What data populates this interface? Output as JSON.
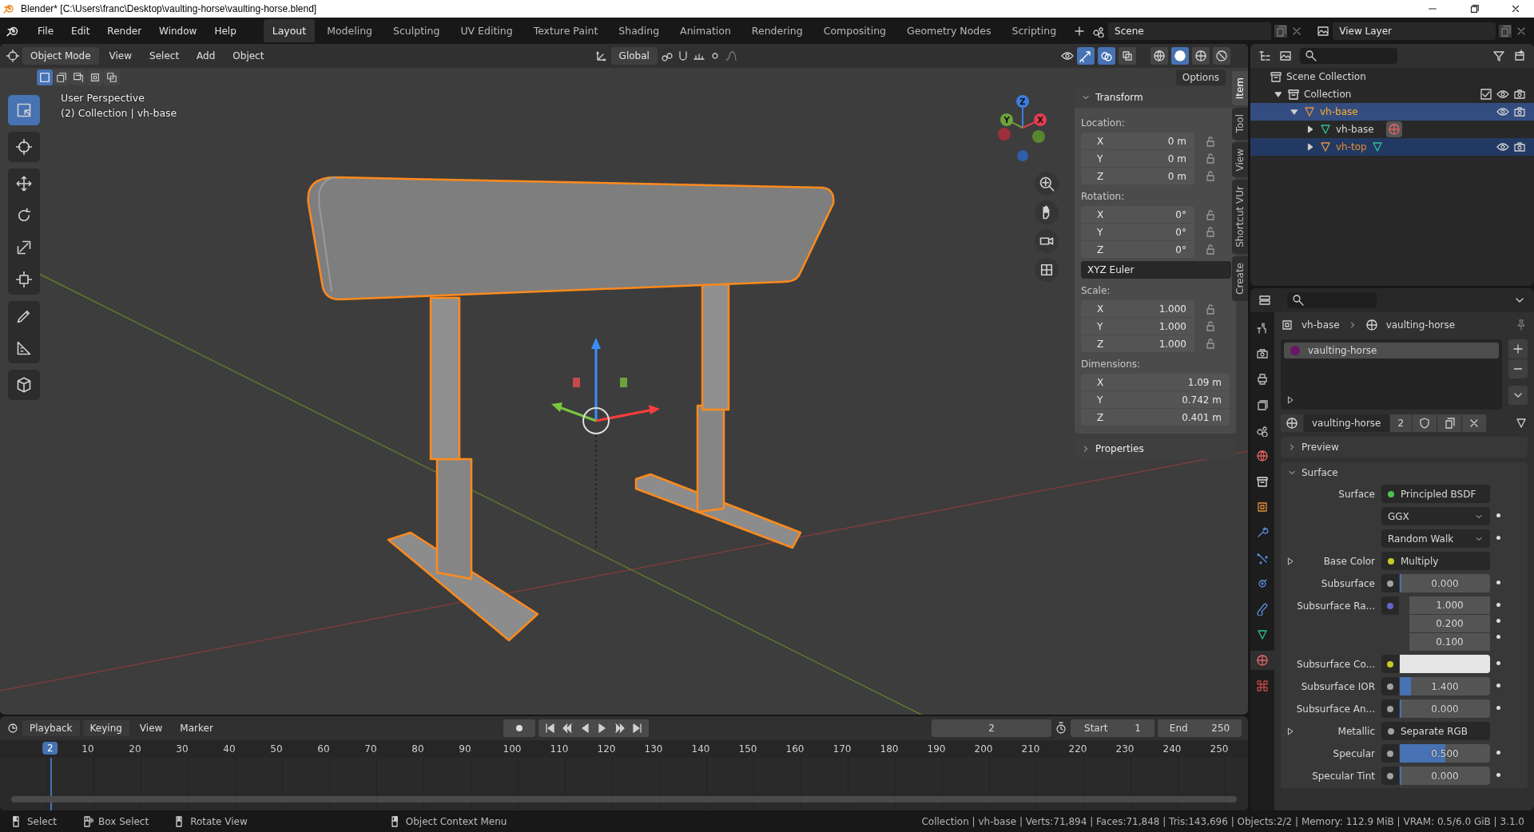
{
  "window": {
    "title": "Blender* [C:\\Users\\franc\\Desktop\\vaulting-horse\\vaulting-horse.blend]"
  },
  "menu": [
    "File",
    "Edit",
    "Render",
    "Window",
    "Help"
  ],
  "workspaces": [
    {
      "label": "Layout",
      "selected": true
    },
    {
      "label": "Modeling",
      "selected": false
    },
    {
      "label": "Sculpting",
      "selected": false
    },
    {
      "label": "UV Editing",
      "selected": false
    },
    {
      "label": "Texture Paint",
      "selected": false
    },
    {
      "label": "Shading",
      "selected": false
    },
    {
      "label": "Animation",
      "selected": false
    },
    {
      "label": "Rendering",
      "selected": false
    },
    {
      "label": "Compositing",
      "selected": false
    },
    {
      "label": "Geometry Nodes",
      "selected": false
    },
    {
      "label": "Scripting",
      "selected": false
    }
  ],
  "scene": {
    "scene": "Scene",
    "view_layer": "View Layer"
  },
  "viewport": {
    "mode": "Object Mode",
    "menus": [
      "View",
      "Select",
      "Add",
      "Object"
    ],
    "orientation": "Global",
    "options": "Options",
    "select_modes": [
      {
        "kind": "set",
        "selected": true
      },
      {
        "kind": "extend",
        "selected": false
      },
      {
        "kind": "subtract",
        "selected": false
      },
      {
        "kind": "invert",
        "selected": false
      },
      {
        "kind": "intersect",
        "selected": false
      }
    ],
    "toggles": [
      {
        "kind": "gizmo",
        "on": true
      },
      {
        "kind": "overlay",
        "on": true
      },
      {
        "kind": "xray",
        "on": false
      }
    ],
    "shading": [
      {
        "kind": "wireframe",
        "selected": false
      },
      {
        "kind": "solid",
        "selected": true
      },
      {
        "kind": "material",
        "selected": false
      },
      {
        "kind": "rendered",
        "selected": false
      }
    ],
    "info": [
      "User Perspective",
      "(2) Collection | vh-base"
    ],
    "tools": [
      {
        "kind": "select",
        "selected": true
      },
      {
        "kind": "cursor",
        "selected": false
      },
      {
        "kind": "move",
        "selected": false
      },
      {
        "kind": "rotate",
        "selected": false
      },
      {
        "kind": "scale",
        "selected": false
      },
      {
        "kind": "transform",
        "selected": false
      },
      {
        "kind": "annotate",
        "selected": false
      },
      {
        "kind": "measure",
        "selected": false
      },
      {
        "kind": "add-cube",
        "selected": false
      }
    ],
    "gizmo_labels": [
      "Z",
      "Y",
      "X"
    ]
  },
  "n_panel": {
    "title": "Transform",
    "groups": [
      {
        "label": "Location:",
        "locks": true,
        "fields": [
          {
            "axis": "X",
            "value": "0 m"
          },
          {
            "axis": "Y",
            "value": "0 m"
          },
          {
            "axis": "Z",
            "value": "0 m"
          }
        ]
      },
      {
        "label": "Rotation:",
        "locks": true,
        "fields": [
          {
            "axis": "X",
            "value": "0°"
          },
          {
            "axis": "Y",
            "value": "0°"
          },
          {
            "axis": "Z",
            "value": "0°"
          }
        ],
        "mode": "XYZ Euler"
      },
      {
        "label": "Scale:",
        "locks": true,
        "fields": [
          {
            "axis": "X",
            "value": "1.000"
          },
          {
            "axis": "Y",
            "value": "1.000"
          },
          {
            "axis": "Z",
            "value": "1.000"
          }
        ]
      },
      {
        "label": "Dimensions:",
        "locks": false,
        "fields": [
          {
            "axis": "X",
            "value": "1.09 m"
          },
          {
            "axis": "Y",
            "value": "0.742 m"
          },
          {
            "axis": "Z",
            "value": "0.401 m"
          }
        ]
      }
    ],
    "properties": "Properties",
    "tabs": [
      {
        "label": "Item",
        "selected": true
      },
      {
        "label": "Tool",
        "selected": false
      },
      {
        "label": "View",
        "selected": false
      },
      {
        "label": "Shortcut VUr",
        "selected": false
      },
      {
        "label": "Create",
        "selected": false
      }
    ]
  },
  "outliner": {
    "root": "Scene Collection",
    "tree": [
      {
        "name": "Collection",
        "kind": "collection",
        "expanded": true,
        "selected": false,
        "active": false,
        "checked": true,
        "visible": true,
        "children": [
          {
            "name": "vh-base",
            "kind": "object",
            "expanded": true,
            "selected": true,
            "active": true,
            "visible": true,
            "children": [
              {
                "name": "vh-base",
                "kind": "mesh",
                "expanded": false,
                "selected": false,
                "active": false
              },
              {
                "name": "vh-top",
                "kind": "object",
                "expanded": false,
                "selected": true,
                "active": false,
                "visible": true
              }
            ]
          }
        ]
      }
    ]
  },
  "properties": {
    "breadcrumb": [
      "vh-base",
      "vaulting-horse"
    ],
    "tabs": [
      {
        "kind": "tool",
        "selected": false
      },
      {
        "kind": "render",
        "selected": false
      },
      {
        "kind": "output",
        "selected": false
      },
      {
        "kind": "view-layer",
        "selected": false
      },
      {
        "kind": "scene",
        "selected": false
      },
      {
        "kind": "world",
        "selected": false
      },
      {
        "kind": "collection",
        "selected": false
      },
      {
        "kind": "object",
        "selected": false
      },
      {
        "kind": "modifier",
        "selected": false
      },
      {
        "kind": "particles",
        "selected": false
      },
      {
        "kind": "physics",
        "selected": false
      },
      {
        "kind": "constraint",
        "selected": false
      },
      {
        "kind": "data",
        "selected": false
      },
      {
        "kind": "material",
        "selected": true
      },
      {
        "kind": "texture",
        "selected": false
      }
    ],
    "slots": [
      {
        "name": "vaulting-horse",
        "selected": true
      }
    ],
    "material": "vaulting-horse",
    "users": "2",
    "sections": [
      {
        "title": "Preview",
        "expanded": false
      },
      {
        "title": "Surface",
        "expanded": true
      }
    ],
    "rows": [
      {
        "kind": "link",
        "label": "Surface",
        "value": "Principled BSDF",
        "color": "#4cc24c",
        "expandable": false
      },
      {
        "kind": "dropdown",
        "value": "GGX"
      },
      {
        "kind": "dropdown",
        "value": "Random Walk"
      },
      {
        "kind": "link",
        "label": "Base Color",
        "value": "Multiply",
        "color": "#c7c729",
        "expandable": true
      },
      {
        "kind": "slider",
        "label": "Subsurface",
        "value": "0.000",
        "level": 0,
        "color": "#a1a1a1"
      },
      {
        "kind": "vector",
        "label": "Subsurface Ra...",
        "values": [
          "1.000",
          "0.200",
          "0.100"
        ],
        "color": "#6363c7"
      },
      {
        "kind": "swatch",
        "label": "Subsurface Co...",
        "color": "#c7c729"
      },
      {
        "kind": "slider",
        "label": "Subsurface IOR",
        "value": "1.400",
        "level": 0.12,
        "color": "#a1a1a1"
      },
      {
        "kind": "slider",
        "label": "Subsurface An...",
        "value": "0.000",
        "level": 0,
        "color": "#a1a1a1"
      },
      {
        "kind": "link",
        "label": "Metallic",
        "value": "Separate RGB",
        "color": "#a1a1a1",
        "expandable": true
      },
      {
        "kind": "slider",
        "label": "Specular",
        "value": "0.500",
        "level": 0.5,
        "color": "#a1a1a1"
      },
      {
        "kind": "slider",
        "label": "Specular Tint",
        "value": "0.000",
        "level": 0,
        "color": "#a1a1a1"
      }
    ]
  },
  "timeline": {
    "menus": [
      "Playback",
      "Keying",
      "View",
      "Marker"
    ],
    "current_frame": "2",
    "playhead_frame": "2",
    "start_label": "Start",
    "start": "1",
    "end_label": "End",
    "end": "250",
    "ticks": [
      "10",
      "20",
      "30",
      "40",
      "50",
      "60",
      "70",
      "80",
      "90",
      "100",
      "110",
      "120",
      "130",
      "140",
      "150",
      "160",
      "170",
      "180",
      "190",
      "200",
      "210",
      "220",
      "230",
      "240",
      "250"
    ]
  },
  "status": {
    "hints": [
      {
        "kind": "left",
        "label": "Select"
      },
      {
        "kind": "drag",
        "label": "Box Select"
      },
      {
        "kind": "middle",
        "label": "Rotate View"
      },
      {
        "kind": "right",
        "label": "Object Context Menu"
      }
    ],
    "stats": "Collection | vh-base | Verts:71,894 | Faces:71,848 | Tris:143,696 | Objects:2/2 | Memory: 112.9 MiB | VRAM: 0.5/6.0 GiB | 3.1.0"
  }
}
